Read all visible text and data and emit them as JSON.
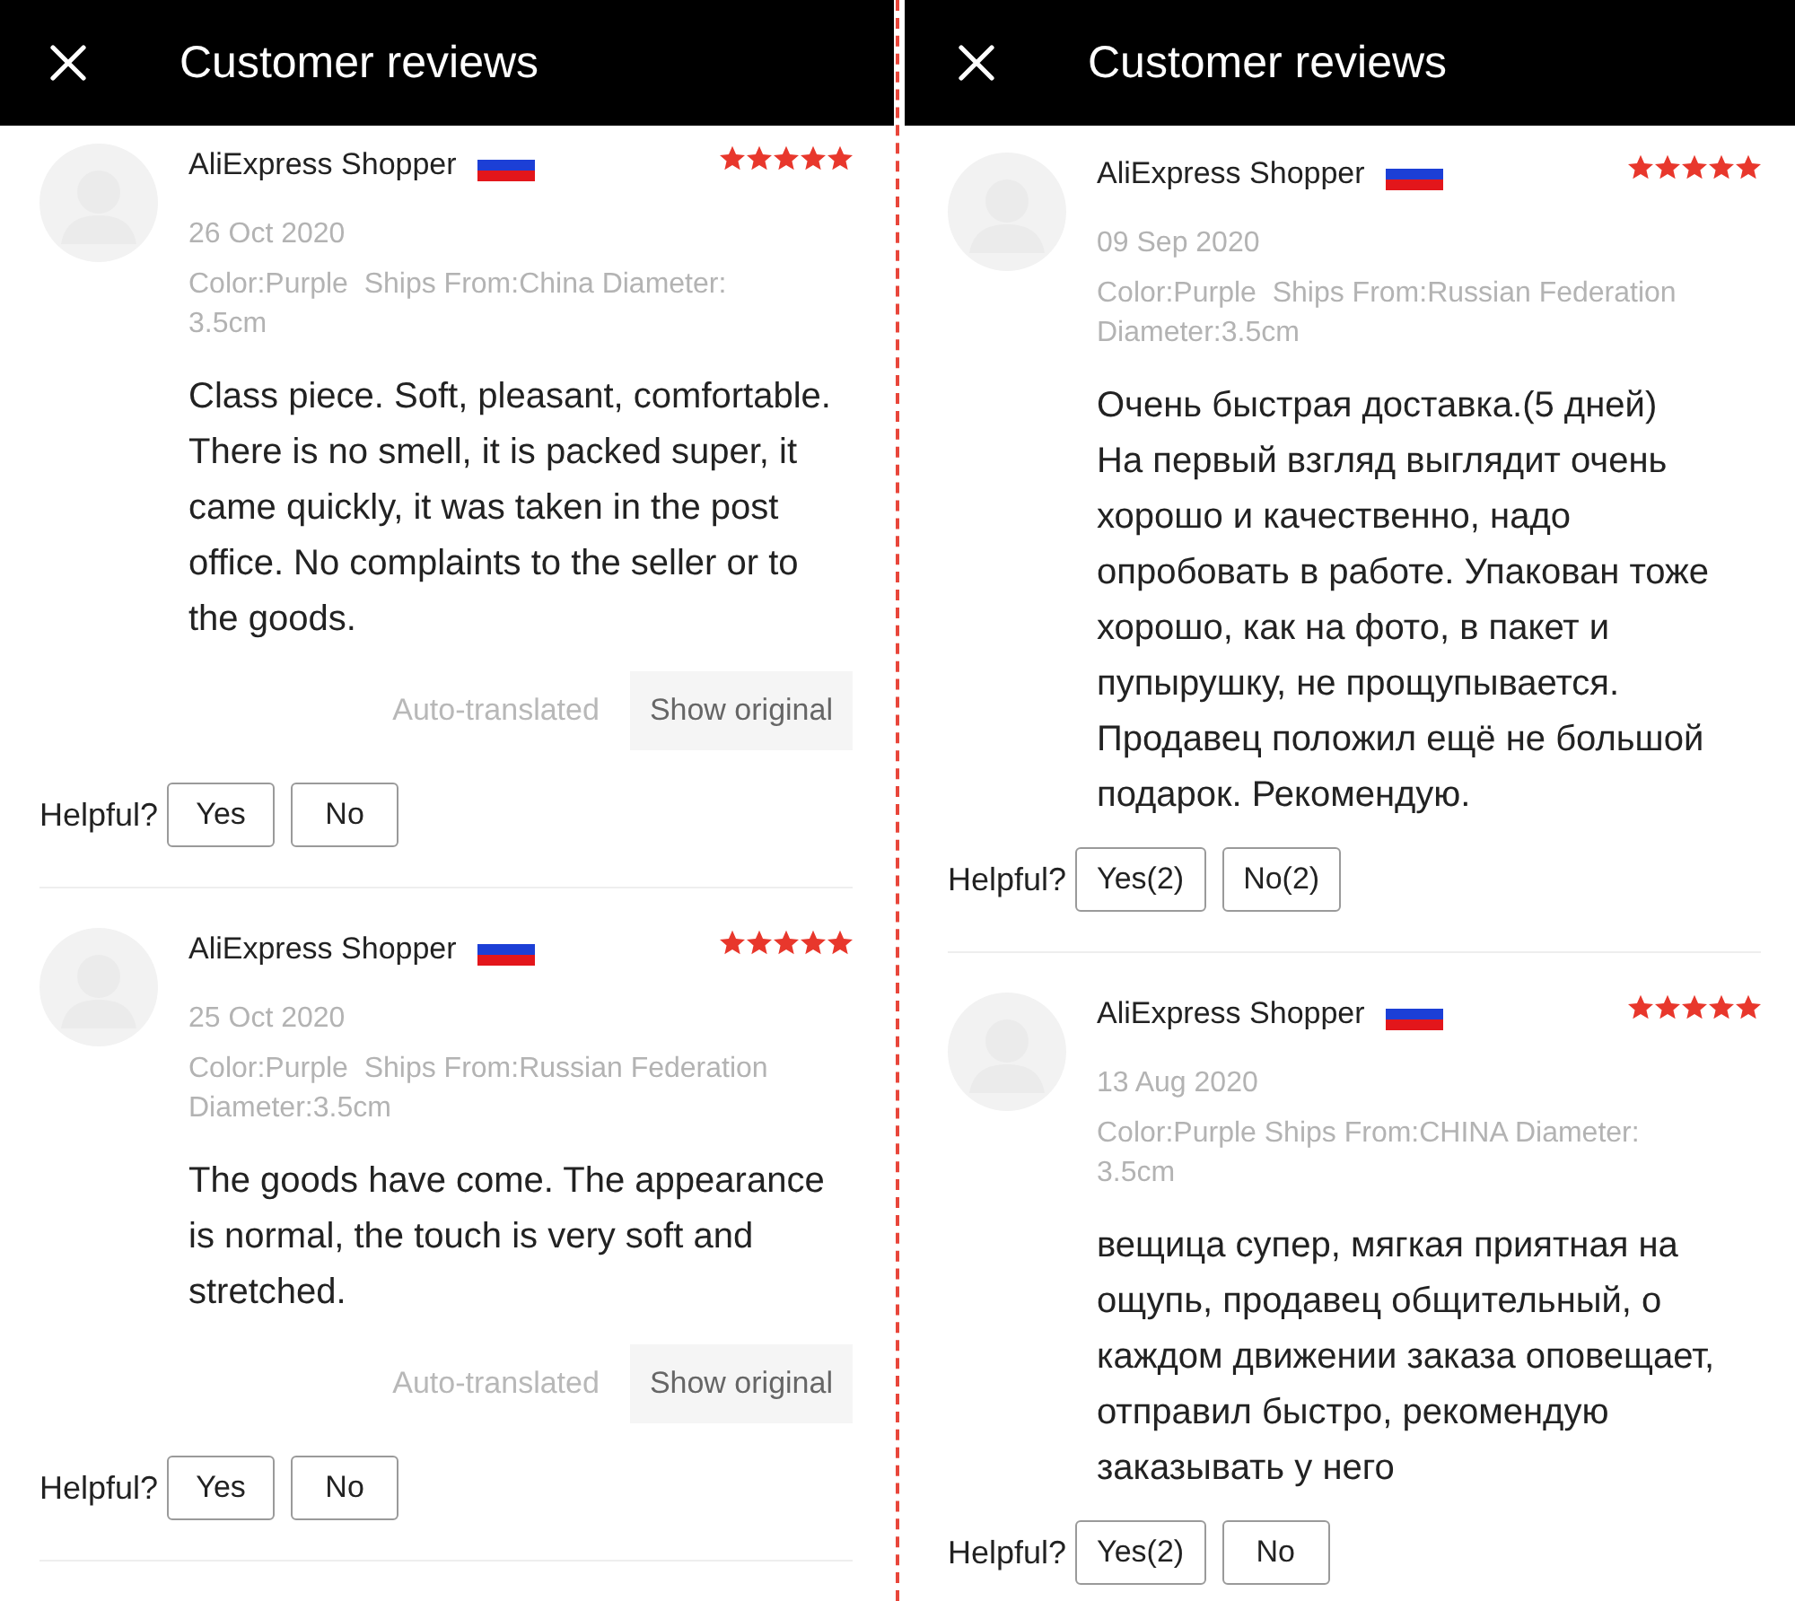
{
  "panels": [
    {
      "header": {
        "title": "Customer reviews"
      },
      "reviews": [
        {
          "author": "AliExpress Shopper",
          "stars": 5,
          "date": "26 Oct 2020",
          "details": "Color:Purple  Ships From:China Diameter: 3.5cm",
          "text": "Class piece. Soft, pleasant, comfortable. There is no smell, it is packed super, it came quickly, it was taken in the post office. No complaints to the seller or to the goods.",
          "translation": {
            "note": "Auto-translated",
            "button": "Show original"
          },
          "helpful": {
            "label": "Helpful?",
            "yes": "Yes",
            "no": "No"
          }
        },
        {
          "author": "AliExpress Shopper",
          "stars": 5,
          "date": "25 Oct 2020",
          "details": "Color:Purple  Ships From:Russian Federation Diameter:3.5cm",
          "text": "The goods have come. The appearance is normal, the touch is very soft and stretched.",
          "translation": {
            "note": "Auto-translated",
            "button": "Show original"
          },
          "helpful": {
            "label": "Helpful?",
            "yes": "Yes",
            "no": "No"
          }
        }
      ]
    },
    {
      "header": {
        "title": "Customer reviews"
      },
      "reviews": [
        {
          "author": "AliExpress Shopper",
          "stars": 5,
          "date": "09 Sep 2020",
          "details": "Color:Purple  Ships From:Russian Federation Diameter:3.5cm",
          "text": "Очень быстрая доставка.(5 дней)\nНа первый взгляд выглядит очень хорошо и качественно, надо опробовать в работе. Упакован тоже хорошо, как на фото, в пакет и пупырушку, не прощупывается. Продавец положил ещё не большой подарок. Рекомендую.",
          "helpful": {
            "label": "Helpful?",
            "yes": "Yes(2)",
            "no": "No(2)"
          }
        },
        {
          "author": "AliExpress Shopper",
          "stars": 5,
          "date": "13 Aug 2020",
          "details": "Color:Purple Ships From:CHINA Diameter: 3.5cm",
          "text": "вещица супер, мягкая приятная на ощупь, продавец общительный, о каждом движении заказа оповещает, отправил быстро, рекомендую заказывать у него",
          "helpful": {
            "label": "Helpful?",
            "yes": "Yes(2)",
            "no": "No"
          }
        }
      ]
    }
  ]
}
